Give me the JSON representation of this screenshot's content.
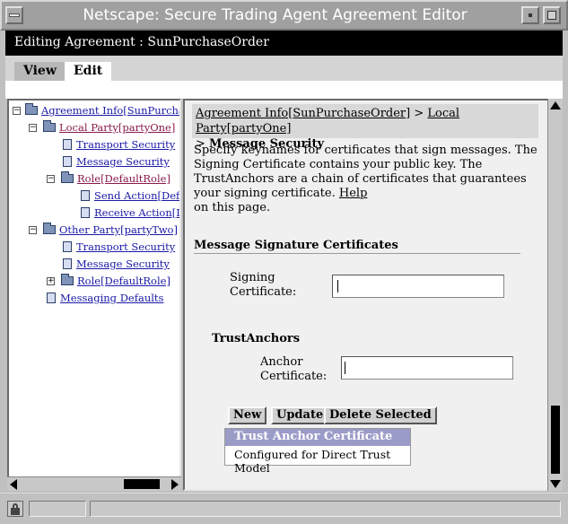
{
  "window": {
    "title": "Netscape: Secure Trading Agent Agreement Editor"
  },
  "header": {
    "editing_label": "Editing Agreement : SunPurchaseOrder"
  },
  "tabs": [
    {
      "label": "View",
      "active": false
    },
    {
      "label": "Edit",
      "active": true
    }
  ],
  "tree": {
    "items": [
      {
        "label": "Agreement Info[SunPurchaseOr",
        "type": "folder",
        "expander": "−"
      },
      {
        "label": "Local Party[partyOne]",
        "type": "folder",
        "expander": "−",
        "visited": true
      },
      {
        "label": "Transport Security",
        "type": "doc"
      },
      {
        "label": "Message Security",
        "type": "doc"
      },
      {
        "label": "Role[DefaultRole]",
        "type": "folder",
        "expander": "−",
        "visited": true
      },
      {
        "label": "Send Action[Defau",
        "type": "doc"
      },
      {
        "label": "Receive Action[De",
        "type": "doc"
      },
      {
        "label": "Other Party[partyTwo]",
        "type": "folder",
        "expander": "−"
      },
      {
        "label": "Transport Security",
        "type": "doc"
      },
      {
        "label": "Message Security",
        "type": "doc"
      },
      {
        "label": "Role[DefaultRole]",
        "type": "folder",
        "expander": "+"
      },
      {
        "label": "Messaging Defaults",
        "type": "doc"
      }
    ]
  },
  "content": {
    "breadcrumb": {
      "link1": "Agreement Info[SunPurchaseOrder]",
      "sep1": ">",
      "link2": "Local Party[partyOne]",
      "sep2": ">",
      "current": "Message Security"
    },
    "description": "Specify keynames for certificates that sign messages. The Signing Certificate contains your public key. The TrustAnchors are a chain of certificates that guarantees your signing certificate.",
    "help_link": "Help",
    "description_suffix": "on this page.",
    "section_title": "Message Signature Certificates",
    "signing_label_1": "Signing",
    "signing_label_2": "Certificate:",
    "signing_value": "",
    "trust_title": "TrustAnchors",
    "anchor_label_1": "Anchor",
    "anchor_label_2": "Certificate:",
    "anchor_value": "",
    "buttons": {
      "new": "New",
      "update": "Update",
      "delete": "Delete Selected"
    },
    "list": {
      "header": "Trust Anchor Certificate",
      "items": [
        "Configured for Direct Trust Model"
      ]
    }
  },
  "colors": {
    "link": "#1a1aa6",
    "visited_link": "#8a1a4a",
    "list_header_bg": "#9b9bc8"
  }
}
